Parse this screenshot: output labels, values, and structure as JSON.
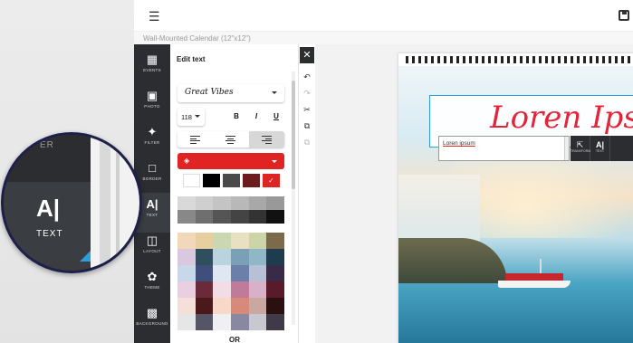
{
  "app": {
    "project_title": "Wall-Mounted Calendar (12\"x12\")"
  },
  "tools": [
    {
      "label": "EVENTS",
      "icon": "calendar-icon"
    },
    {
      "label": "PHOTO",
      "icon": "photo-icon"
    },
    {
      "label": "FILTER",
      "icon": "magic-wand-icon"
    },
    {
      "label": "BORDER",
      "icon": "border-icon"
    },
    {
      "label": "TEXT",
      "icon": "text-icon",
      "active": true
    },
    {
      "label": "LAYOUT",
      "icon": "layout-icon"
    },
    {
      "label": "THEME",
      "icon": "palette-icon"
    },
    {
      "label": "BACKGROUND",
      "icon": "background-icon"
    }
  ],
  "edit_panel": {
    "title": "Edit text",
    "font": "Great Vibes",
    "font_size": "118",
    "bold": "B",
    "italic": "I",
    "underline": "U",
    "text_color": "#e02424",
    "or_label": "OR",
    "swatches": [
      "#ffffff",
      "#000000",
      "#4a4a4a",
      "#6b1d1d",
      "#e02424"
    ],
    "grays": [
      "#d9d9d9",
      "#cfcfcf",
      "#c4c4c4",
      "#b8b8b8",
      "#a8a8a8",
      "#999999",
      "#888888",
      "#6f6f6f",
      "#555555",
      "#444444",
      "#333333",
      "#111111"
    ],
    "palette_rows": [
      [
        "#f0d8b8",
        "#e8cfa0",
        "#c9d8b0",
        "#e8e0c0",
        "#cbd5a8",
        "#7c6a4a"
      ],
      [
        "#d9c8e0",
        "#2f4f5f",
        "#b9d3df",
        "#7aa0b8",
        "#8fb7c7",
        "#1f3b4f"
      ],
      [
        "#c8d8e8",
        "#3d4f7a",
        "#dfe8f2",
        "#6c7fa8",
        "#b8c0d8",
        "#3a2a4a"
      ],
      [
        "#e8d0e0",
        "#6a2a3a",
        "#f2dce6",
        "#c07a9a",
        "#d8b0c8",
        "#5a1a2a"
      ],
      [
        "#f4e0d8",
        "#4a1a1a",
        "#f8d8c8",
        "#d88a7a",
        "#c8a8a0",
        "#2a1010"
      ],
      [
        "#e6e6e6",
        "#555566",
        "#f0f0f4",
        "#8888a0",
        "#c8c8d0",
        "#403a48"
      ]
    ]
  },
  "side_tools": [
    {
      "icon": "undo-icon",
      "disabled": false
    },
    {
      "icon": "redo-icon",
      "disabled": true
    },
    {
      "icon": "cut-icon",
      "disabled": false
    },
    {
      "icon": "copy-icon",
      "disabled": false
    },
    {
      "icon": "paste-icon",
      "disabled": true
    }
  ],
  "canvas": {
    "title_text": "Loren Ipsu",
    "text_input_value": "Loren ipsum",
    "accent_color": "#2a9fd8",
    "title_color": "#e2263a",
    "float_tools": [
      {
        "label": "TRANSFORM",
        "icon": "transform-icon"
      },
      {
        "label": "TEXT",
        "icon": "text-icon"
      }
    ]
  },
  "lens": {
    "top_label": "ER",
    "icon_text": "A|",
    "label": "TEXT"
  }
}
